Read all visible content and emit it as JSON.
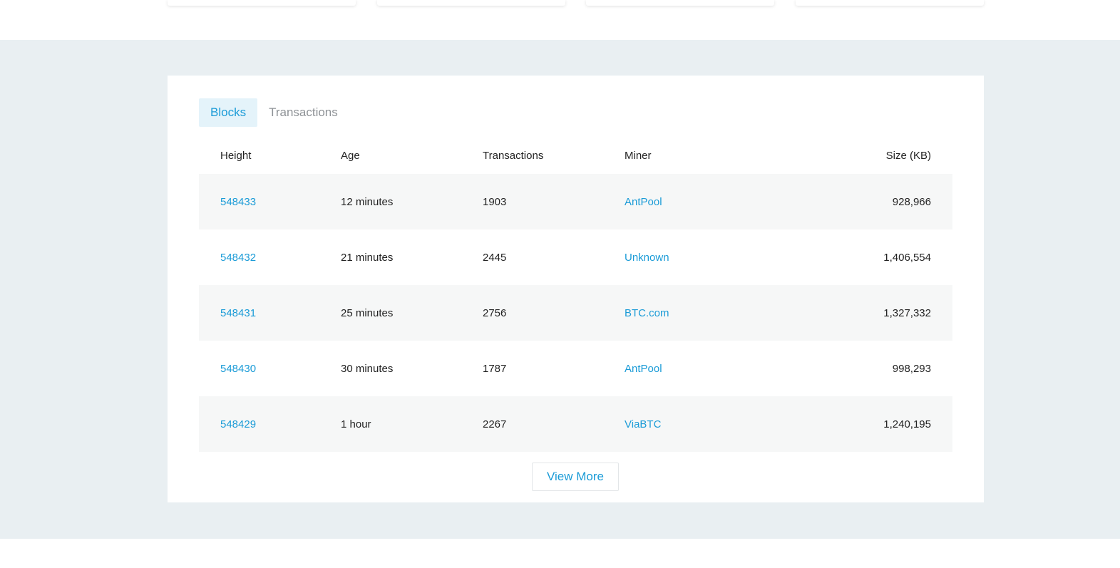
{
  "tabs": [
    {
      "label": "Blocks",
      "active": true
    },
    {
      "label": "Transactions",
      "active": false
    }
  ],
  "table": {
    "headers": {
      "height": "Height",
      "age": "Age",
      "transactions": "Transactions",
      "miner": "Miner",
      "size": "Size (KB)"
    },
    "rows": [
      {
        "height": "548433",
        "age": "12 minutes",
        "transactions": "1903",
        "miner": "AntPool",
        "size": "928,966"
      },
      {
        "height": "548432",
        "age": "21 minutes",
        "transactions": "2445",
        "miner": "Unknown",
        "size": "1,406,554"
      },
      {
        "height": "548431",
        "age": "25 minutes",
        "transactions": "2756",
        "miner": "BTC.com",
        "size": "1,327,332"
      },
      {
        "height": "548430",
        "age": "30 minutes",
        "transactions": "1787",
        "miner": "AntPool",
        "size": "998,293"
      },
      {
        "height": "548429",
        "age": "1 hour",
        "transactions": "2267",
        "miner": "ViaBTC",
        "size": "1,240,195"
      }
    ]
  },
  "view_more_label": "View More",
  "colors": {
    "accent": "#1a9bd7",
    "band_background": "#e9eff2",
    "row_shade": "#f6f7f7"
  }
}
